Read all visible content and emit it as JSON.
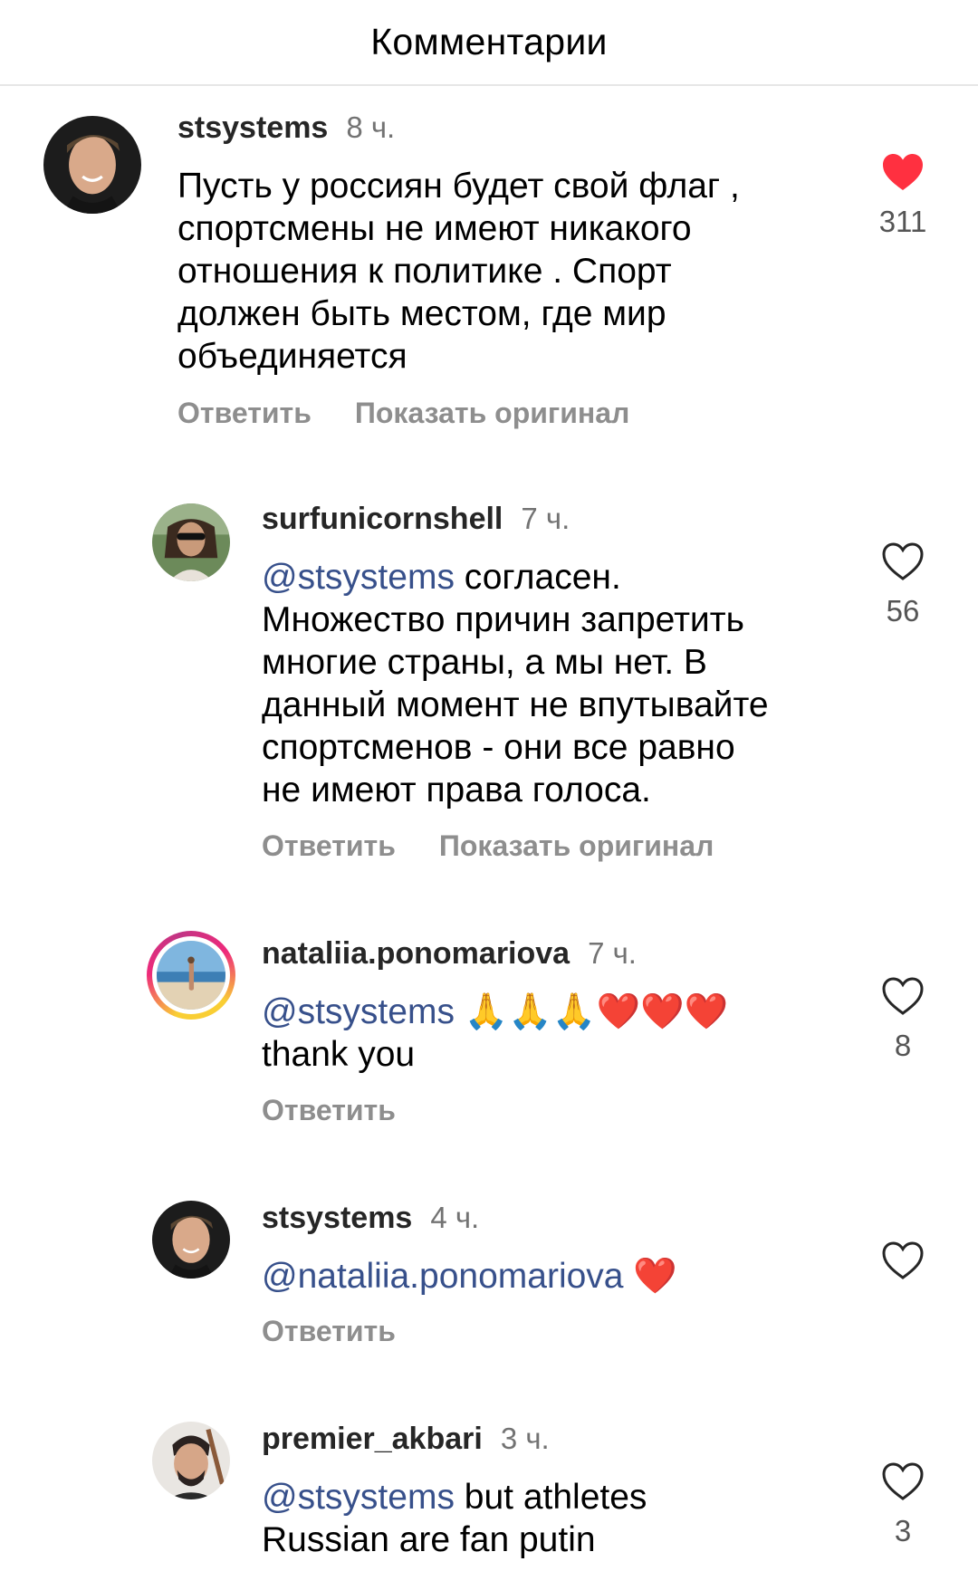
{
  "header": {
    "title": "Комментарии"
  },
  "comments": [
    {
      "username": "stsystems",
      "time": "8 ч.",
      "lines": [
        "Пусть у россиян будет свой флаг ,",
        "спортсмены не имеют никакого",
        "отношения к политике . Спорт",
        "должен быть местом, где мир",
        "объединяется"
      ],
      "reply_label": "Ответить",
      "show_original_label": "Показать оригинал",
      "likes": "311",
      "liked": true
    },
    {
      "username": "surfunicornshell",
      "time": "7 ч.",
      "mention": "@stsystems",
      "lines": [
        " согласен.",
        "Множество причин запретить",
        "многие страны, а мы нет. В",
        "данный момент не впутывайте",
        "спортсменов - они все равно",
        "не имеют права голоса."
      ],
      "reply_label": "Ответить",
      "show_original_label": "Показать оригинал",
      "likes": "56",
      "liked": false
    },
    {
      "username": "nataliia.ponomariova",
      "time": "7 ч.",
      "mention": "@stsystems",
      "emoji": "🙏🙏🙏❤️❤️❤️",
      "lines": [
        "thank you"
      ],
      "reply_label": "Ответить",
      "likes": "8",
      "liked": false
    },
    {
      "username": "stsystems",
      "time": "4 ч.",
      "mention": "@nataliia.ponomariova",
      "emoji": "❤️",
      "reply_label": "Ответить",
      "likes": "",
      "liked": false
    },
    {
      "username": "premier_akbari",
      "time": "3 ч.",
      "mention": "@stsystems",
      "lines": [
        " but athletes",
        "Russian are fan putin"
      ],
      "likes": "3",
      "liked": false
    }
  ],
  "icons": {
    "liked_heart": "heart-filled-icon",
    "heart": "heart-outline-icon",
    "liked_color": "#ff3040",
    "mention_color": "#37508b"
  }
}
